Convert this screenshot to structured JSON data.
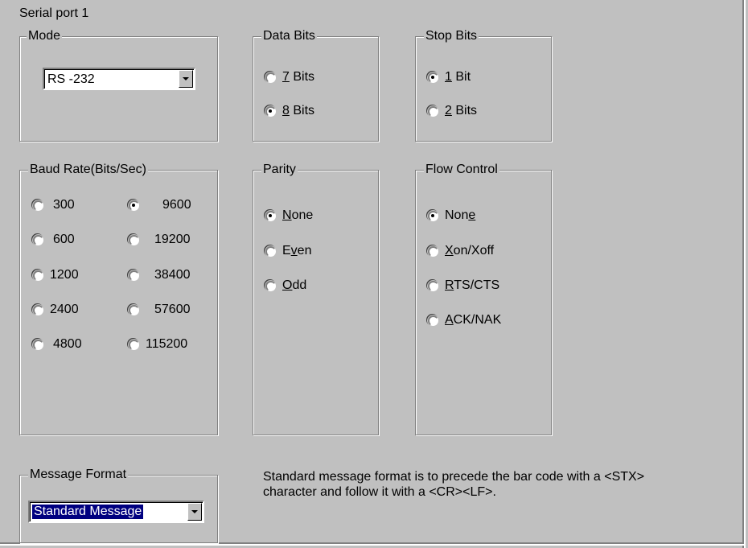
{
  "section_title": "Serial port 1",
  "mode": {
    "legend": "Mode",
    "value": "RS -232"
  },
  "data_bits": {
    "legend": "Data Bits",
    "options": [
      {
        "mnemonic": "7",
        "rest": " Bits",
        "checked": false
      },
      {
        "mnemonic": "8",
        "rest": " Bits",
        "checked": true
      }
    ]
  },
  "stop_bits": {
    "legend": "Stop Bits",
    "options": [
      {
        "mnemonic": "1",
        "rest": " Bit",
        "checked": true
      },
      {
        "mnemonic": "2",
        "rest": " Bits",
        "checked": false
      }
    ]
  },
  "baud_rate": {
    "legend": "Baud Rate(Bits/Sec)",
    "options": [
      {
        "label": "300",
        "checked": false
      },
      {
        "label": "600",
        "checked": false
      },
      {
        "label": "1200",
        "checked": false
      },
      {
        "label": "2400",
        "checked": false
      },
      {
        "label": "4800",
        "checked": false
      },
      {
        "label": "9600",
        "checked": true
      },
      {
        "label": "19200",
        "checked": false
      },
      {
        "label": "38400",
        "checked": false
      },
      {
        "label": "57600",
        "checked": false
      },
      {
        "label": "115200",
        "checked": false
      }
    ]
  },
  "parity": {
    "legend": "Parity",
    "options": [
      {
        "pre": "",
        "mnemonic": "N",
        "rest": "one",
        "checked": true
      },
      {
        "pre": "E",
        "mnemonic": "v",
        "rest": "en",
        "checked": false
      },
      {
        "pre": "",
        "mnemonic": "O",
        "rest": "dd",
        "checked": false
      }
    ]
  },
  "flow_control": {
    "legend": "Flow Control",
    "options": [
      {
        "pre": "Non",
        "mnemonic": "e",
        "rest": "",
        "checked": true
      },
      {
        "pre": "",
        "mnemonic": "X",
        "rest": "on/Xoff",
        "checked": false
      },
      {
        "pre": "",
        "mnemonic": "R",
        "rest": "TS/CTS",
        "checked": false
      },
      {
        "pre": "",
        "mnemonic": "A",
        "rest": "CK/NAK",
        "checked": false
      }
    ]
  },
  "message_format": {
    "legend": "Message Format",
    "value": "Standard Message"
  },
  "note": {
    "line1": "Standard message format is to precede the bar code with a <STX>",
    "line2": "character and follow it with a <CR><LF>."
  }
}
